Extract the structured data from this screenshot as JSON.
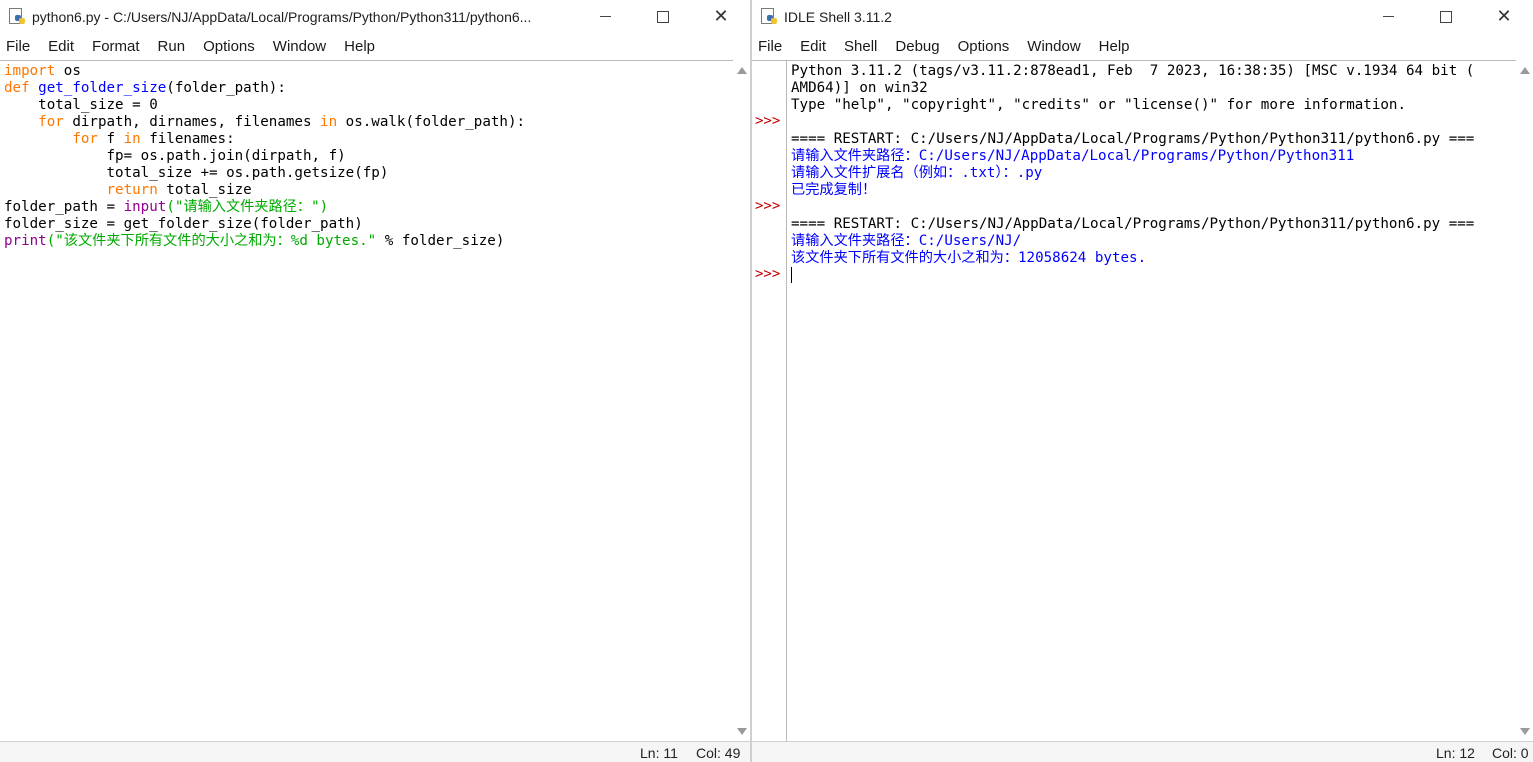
{
  "editor": {
    "title": "python6.py - C:/Users/NJ/AppData/Local/Programs/Python/Python311/python6...",
    "menu": [
      "File",
      "Edit",
      "Format",
      "Run",
      "Options",
      "Window",
      "Help"
    ],
    "code": [
      [
        {
          "t": "import",
          "c": "kw"
        },
        {
          "t": " os"
        }
      ],
      [
        {
          "t": "def",
          "c": "kw"
        },
        {
          "t": " "
        },
        {
          "t": "get_folder_size",
          "c": "fn"
        },
        {
          "t": "(folder_path):"
        }
      ],
      [
        {
          "t": "    total_size = 0"
        }
      ],
      [
        {
          "t": "    "
        },
        {
          "t": "for",
          "c": "kw"
        },
        {
          "t": " dirpath, dirnames, filenames "
        },
        {
          "t": "in",
          "c": "kw"
        },
        {
          "t": " os.walk(folder_path):"
        }
      ],
      [
        {
          "t": "        "
        },
        {
          "t": "for",
          "c": "kw"
        },
        {
          "t": " f "
        },
        {
          "t": "in",
          "c": "kw"
        },
        {
          "t": " filenames:"
        }
      ],
      [
        {
          "t": "            fp= os.path.join(dirpath, f)"
        }
      ],
      [
        {
          "t": "            total_size += os.path.getsize(fp)"
        }
      ],
      [
        {
          "t": "            "
        },
        {
          "t": "return",
          "c": "kw"
        },
        {
          "t": " total_size"
        }
      ],
      [
        {
          "t": "folder_path = "
        },
        {
          "t": "input",
          "c": "bi"
        },
        {
          "t": "(\"请输入文件夹路径：\")",
          "c": "str"
        },
        {
          "t": ""
        }
      ],
      [
        {
          "t": "folder_size = get_folder_size(folder_path)"
        }
      ],
      [
        {
          "t": "print",
          "c": "bi"
        },
        {
          "t": "(\"该文件夹下所有文件的大小之和为：%d bytes.\"",
          "c": "str"
        },
        {
          "t": " % folder_size)"
        }
      ]
    ],
    "status": {
      "ln": "Ln: 11",
      "col": "Col: 49"
    }
  },
  "shell": {
    "title": "IDLE Shell 3.11.2",
    "menu": [
      "File",
      "Edit",
      "Shell",
      "Debug",
      "Options",
      "Window",
      "Help"
    ],
    "prompt": ">>>",
    "lines": [
      {
        "t": "Python 3.11.2 (tags/v3.11.2:878ead1, Feb  7 2023, 16:38:35) [MSC v.1934 64 bit (",
        "c": ""
      },
      {
        "t": "AMD64)] on win32",
        "c": ""
      },
      {
        "t": "Type \"help\", \"copyright\", \"credits\" or \"license()\" for more information.",
        "c": ""
      },
      {
        "t": "",
        "c": ""
      },
      {
        "t": "==== RESTART: C:/Users/NJ/AppData/Local/Programs/Python/Python311/python6.py ===",
        "c": ""
      },
      {
        "t": "请输入文件夹路径：C:/Users/NJ/AppData/Local/Programs/Python/Python311",
        "c": "out"
      },
      {
        "t": "请输入文件扩展名（例如：.txt）：.py",
        "c": "out"
      },
      {
        "t": "已完成复制！",
        "c": "out"
      },
      {
        "t": "",
        "c": ""
      },
      {
        "t": "==== RESTART: C:/Users/NJ/AppData/Local/Programs/Python/Python311/python6.py ===",
        "c": ""
      },
      {
        "t": "请输入文件夹路径：C:/Users/NJ/",
        "c": "out"
      },
      {
        "t": "该文件夹下所有文件的大小之和为：12058624 bytes.",
        "c": "out"
      }
    ],
    "status": {
      "ln": "Ln: 12",
      "col": "Col: 0"
    }
  }
}
